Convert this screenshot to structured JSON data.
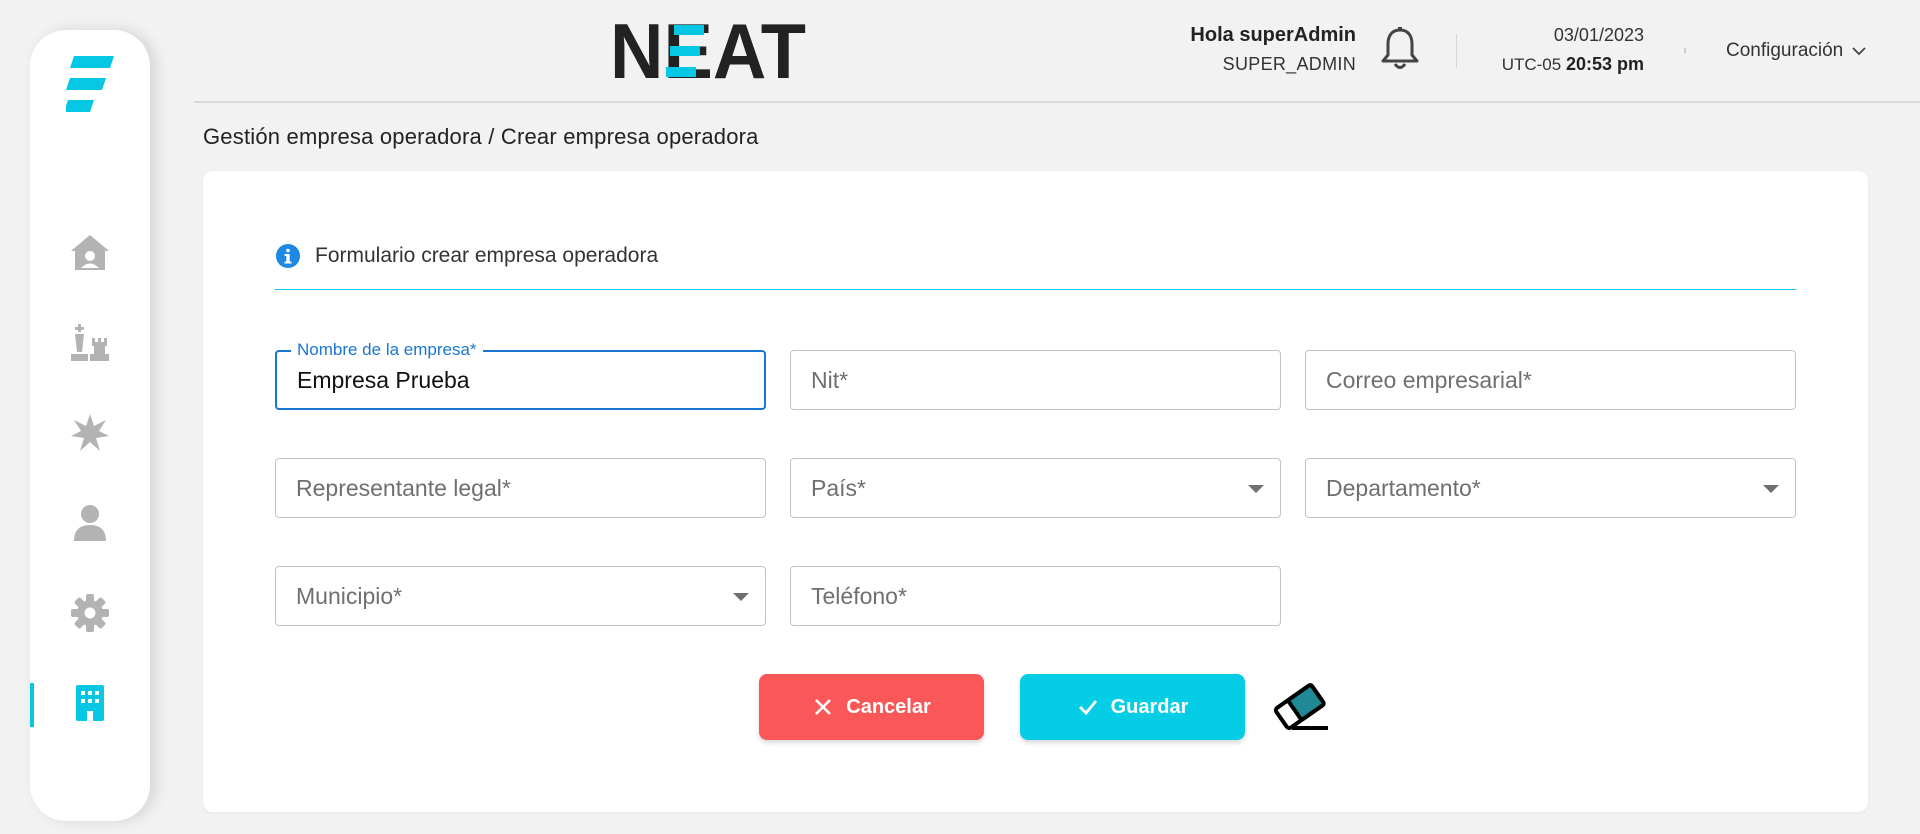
{
  "colors": {
    "accent": "#06c8e4",
    "cancel": "#fa5858",
    "save": "#06cde6",
    "focus": "#1976d2",
    "nav_icon": "#b3b3b3"
  },
  "brand": {
    "logo_text": "NEAT"
  },
  "sidebar": {
    "items": [
      {
        "icon": "home-icon",
        "active": false
      },
      {
        "icon": "chess-icon",
        "active": false
      },
      {
        "icon": "burst-icon",
        "active": false
      },
      {
        "icon": "user-icon",
        "active": false
      },
      {
        "icon": "gear-icon",
        "active": false
      },
      {
        "icon": "building-icon",
        "active": true
      }
    ]
  },
  "header": {
    "greeting": "Hola superAdmin",
    "role": "SUPER_ADMIN",
    "date": "03/01/2023",
    "timezone": "UTC-05",
    "time": "20:53 pm",
    "config_label": "Configuración"
  },
  "breadcrumb": "Gestión empresa operadora / Crear empresa operadora",
  "form": {
    "title": "Formulario crear empresa operadora",
    "fields": {
      "company_name": {
        "label": "Nombre de la empresa*",
        "value": "Empresa Prueba"
      },
      "nit": {
        "placeholder": "Nit*"
      },
      "email": {
        "placeholder": "Correo empresarial*"
      },
      "legal_rep": {
        "placeholder": "Representante legal*"
      },
      "country": {
        "placeholder": "País*"
      },
      "department": {
        "placeholder": "Departamento*"
      },
      "municipality": {
        "placeholder": "Municipio*"
      },
      "phone": {
        "placeholder": "Teléfono*"
      }
    },
    "cancel_label": "Cancelar",
    "save_label": "Guardar"
  }
}
